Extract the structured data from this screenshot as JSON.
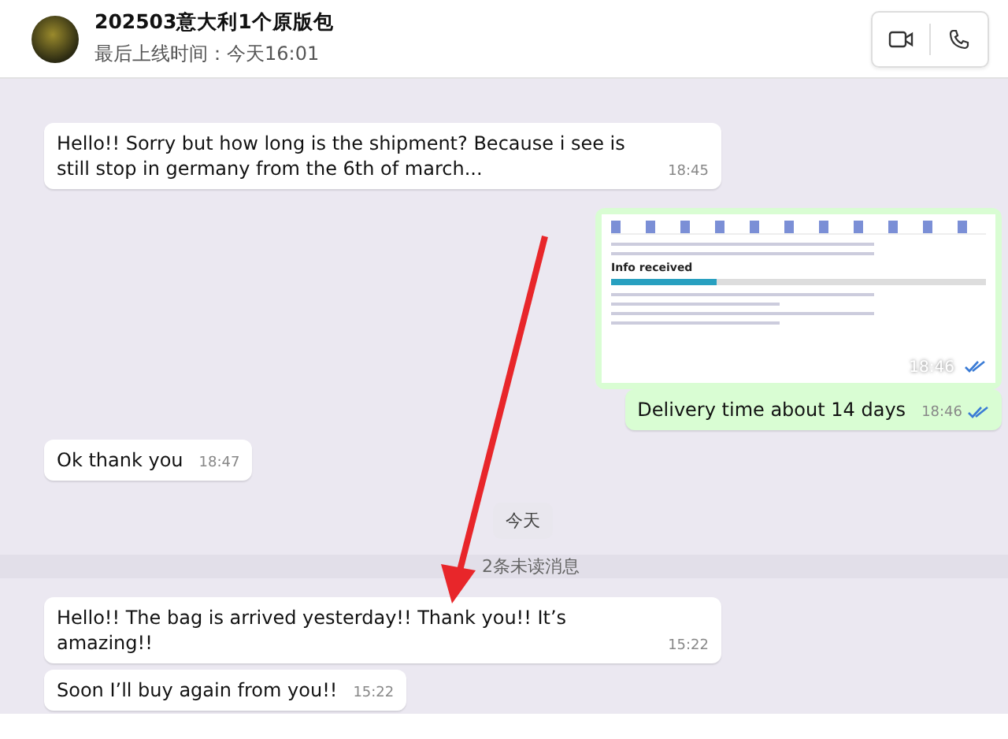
{
  "header": {
    "contact_name": "202503意大利1个原版包",
    "last_seen": "最后上线时间：今天16:01"
  },
  "messages": [
    {
      "kind": "incoming",
      "text": "Hello!! Sorry but how long is the shipment? Because i see is still stop in germany from the 6th of march...",
      "time": "18:45"
    },
    {
      "kind": "image",
      "heading": "Info received",
      "time": "18:46",
      "read": true
    },
    {
      "kind": "outgoing",
      "text": "Delivery time about 14 days",
      "time": "18:46",
      "read": true
    },
    {
      "kind": "incoming",
      "text": "Ok thank you",
      "time": "18:47"
    },
    {
      "kind": "date",
      "text": "今天"
    },
    {
      "kind": "unread",
      "text": "2条未读消息"
    },
    {
      "kind": "incoming",
      "text": "Hello!! The bag is arrived yesterday!! Thank you!! It’s amazing!!",
      "time": "15:22"
    },
    {
      "kind": "incoming",
      "text": "Soon I’ll buy again from you!!",
      "time": "15:22"
    }
  ]
}
